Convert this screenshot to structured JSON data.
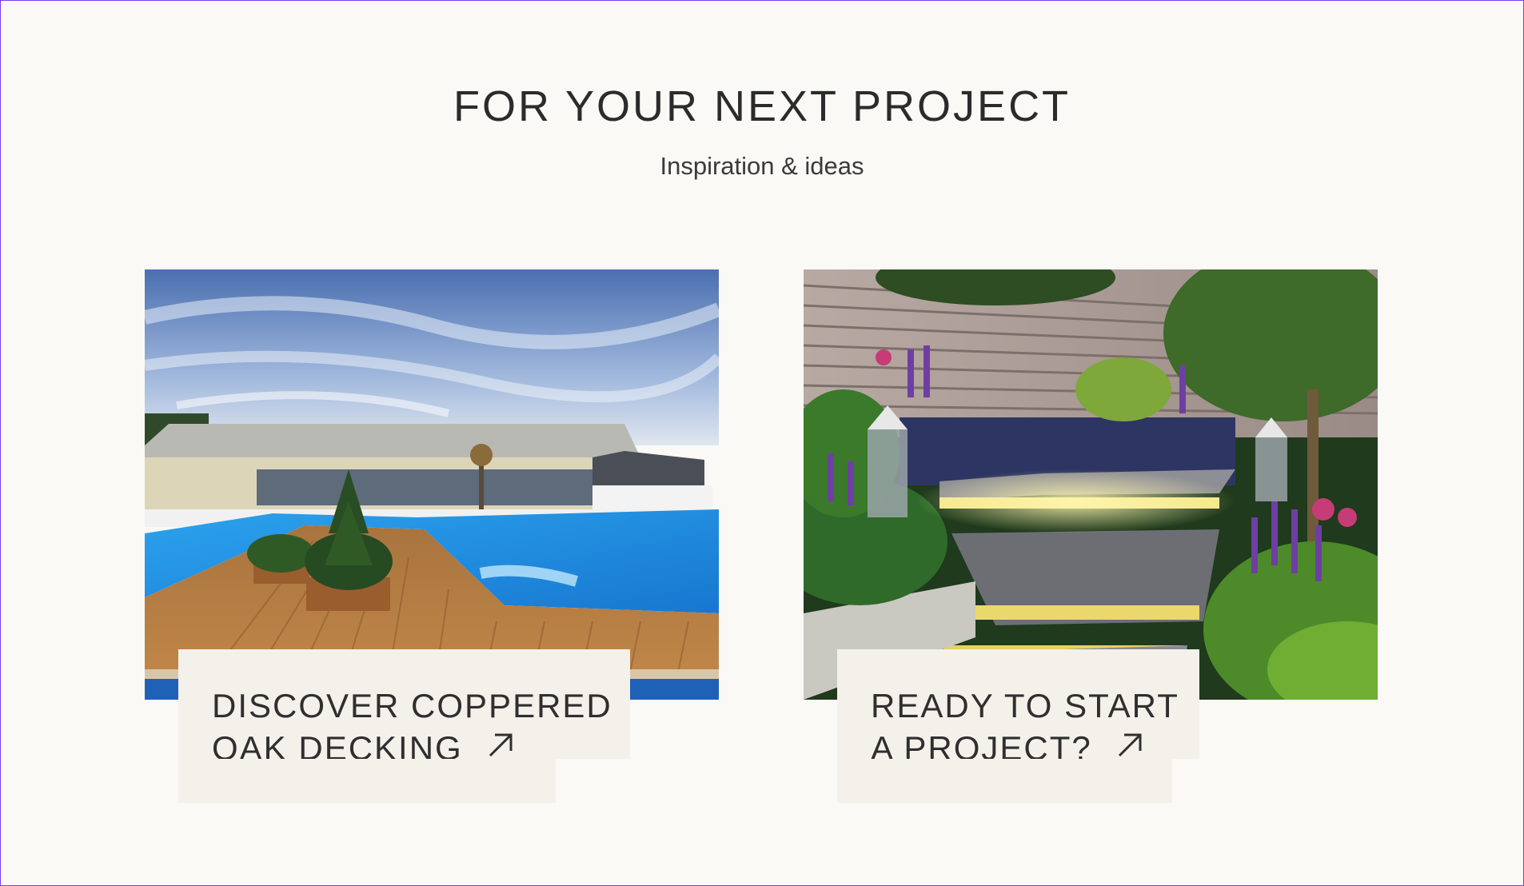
{
  "section": {
    "title": "FOR YOUR NEXT PROJECT",
    "subtitle": "Inspiration & ideas"
  },
  "cards": [
    {
      "image_alt": "Pool surrounded by coppered oak decking",
      "cta_line1": "DISCOVER COPPERED",
      "cta_line2": "OAK DECKING",
      "icon": "arrow-up-right-icon"
    },
    {
      "image_alt": "Garden with lit steps and bench",
      "cta_line1": "READY TO START",
      "cta_line2": "A PROJECT?",
      "icon": "arrow-up-right-icon"
    }
  ],
  "colors": {
    "background": "#faf9f5",
    "cta_background": "#f4f1eb",
    "text": "#2b2b2b"
  }
}
